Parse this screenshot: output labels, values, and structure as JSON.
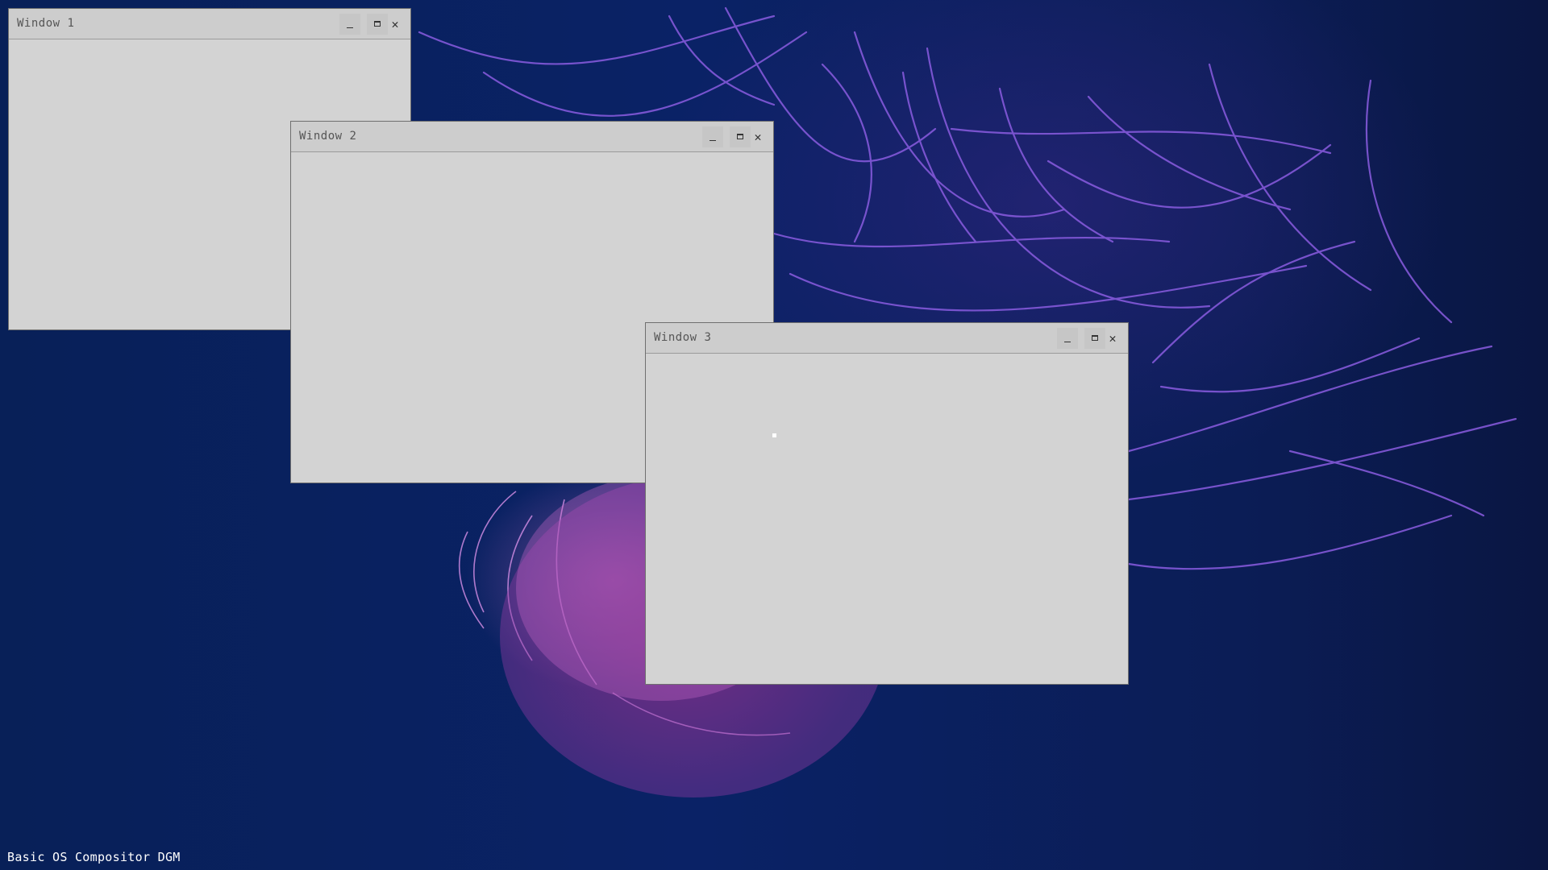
{
  "desktop": {
    "wallpaper": "jellyfish-wallpaper",
    "colors": {
      "background": "#0a2266",
      "tendril": "#7b4fd0",
      "jellyfish": "#c05ab8"
    },
    "footer_label": "Basic OS Compositor DGM"
  },
  "windows": [
    {
      "title": "Window 1",
      "minimize_icon": "minimize-icon",
      "maximize_icon": "maximize-icon",
      "close_glyph": "✕"
    },
    {
      "title": "Window 2",
      "minimize_icon": "minimize-icon",
      "maximize_icon": "maximize-icon",
      "close_glyph": "✕"
    },
    {
      "title": "Window 3",
      "minimize_icon": "minimize-icon",
      "maximize_icon": "maximize-icon",
      "close_glyph": "✕"
    }
  ],
  "cursor": {
    "icon": "mouse-cursor-icon"
  }
}
